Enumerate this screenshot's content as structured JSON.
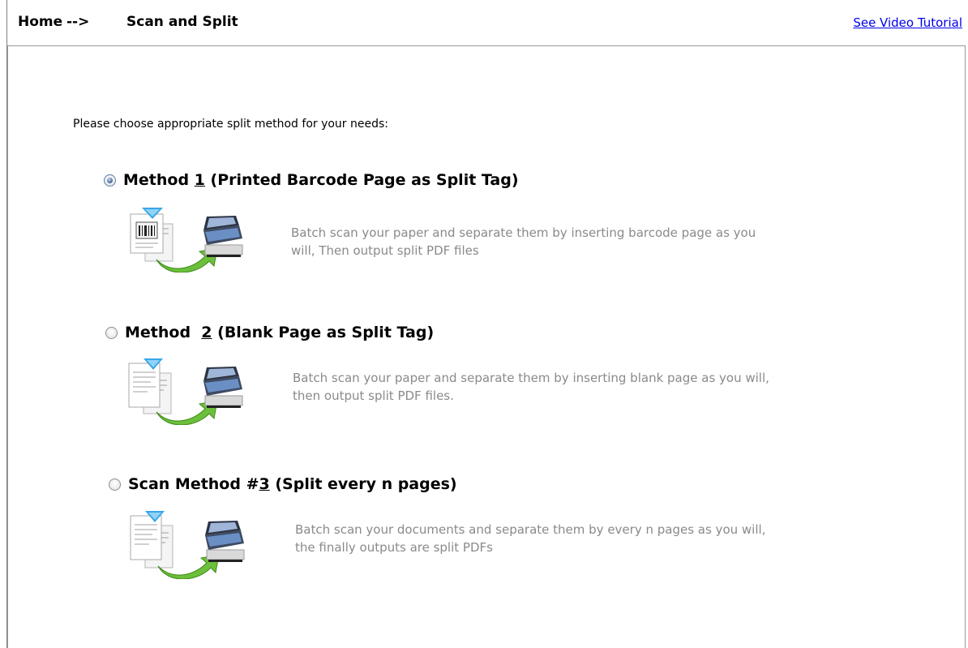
{
  "breadcrumb": {
    "home": "Home",
    "separator": "-->",
    "current": "Scan and Split"
  },
  "header": {
    "video_link": "See Video Tutorial"
  },
  "instructions": "Please choose appropriate split method for your needs:",
  "methods": [
    {
      "title_before": "Method ",
      "hotkey": "1",
      "title_after": " (Printed Barcode Page as Split Tag)",
      "selected": true,
      "icon": "barcode-page-scanner-icon",
      "desc_line1": "Batch scan your paper and separate them by inserting barcode page as you",
      "desc_line2": "will, Then output split PDF files"
    },
    {
      "title_before": "Method  ",
      "hotkey": "2",
      "title_after": " (Blank Page as Split Tag)",
      "selected": false,
      "icon": "blank-page-scanner-icon",
      "desc_line1": "Batch scan your paper and separate them by inserting blank page as you will,",
      "desc_line2": "then output split PDF files."
    },
    {
      "title_before": "Scan Method #",
      "hotkey": "3",
      "title_after": " (Split every n pages)",
      "selected": false,
      "icon": "every-n-pages-scanner-icon",
      "desc_line1": "Batch scan your documents and separate them by every n pages as you will,",
      "desc_line2": "the finally outputs are split PDFs"
    }
  ],
  "colors": {
    "link": "#0000ee",
    "description": "#8a8a8a",
    "border": "#999999"
  }
}
